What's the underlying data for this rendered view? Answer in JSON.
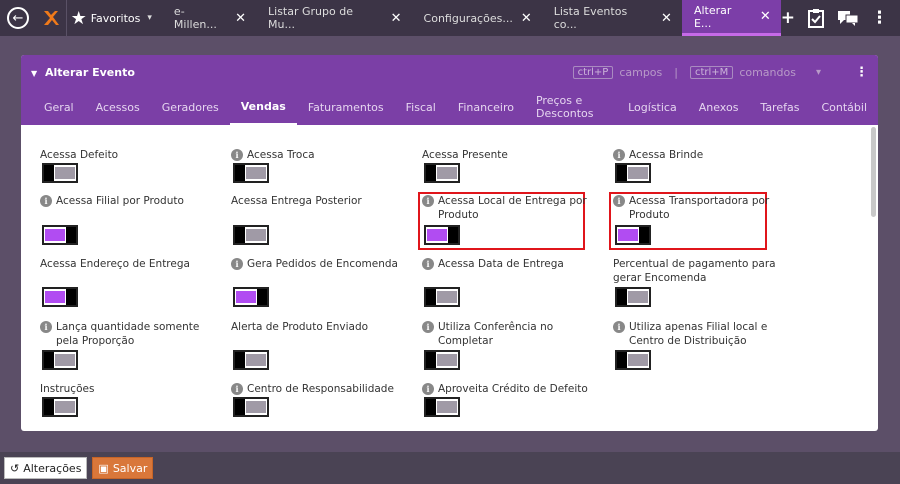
{
  "topbar": {
    "favorites_label": "Favoritos",
    "tabs": [
      {
        "label": "e-Millen..."
      },
      {
        "label": "Listar Grupo de Mu..."
      },
      {
        "label": "Configurações..."
      },
      {
        "label": "Lista Eventos co..."
      },
      {
        "label": "Alterar E..."
      }
    ],
    "close_glyph": "✕"
  },
  "panel": {
    "title": "Alterar Evento",
    "shortcut_fields_key": "ctrl+P",
    "shortcut_fields_label": "campos",
    "shortcut_commands_key": "ctrl+M",
    "shortcut_commands_label": "comandos",
    "tabs": [
      "Geral",
      "Acessos",
      "Geradores",
      "Vendas",
      "Faturamentos",
      "Fiscal",
      "Financeiro",
      "Preços e Descontos",
      "Logística",
      "Anexos",
      "Tarefas",
      "Contábil"
    ],
    "active_tab": "Vendas"
  },
  "fields": [
    {
      "label": "Acessa Defeito",
      "info": false,
      "on": false
    },
    {
      "label": "Acessa Troca",
      "info": true,
      "on": false
    },
    {
      "label": "Acessa Presente",
      "info": false,
      "on": false
    },
    {
      "label": "Acessa Brinde",
      "info": true,
      "on": false
    },
    {
      "label": "Acessa Filial por Produto",
      "info": true,
      "on": true
    },
    {
      "label": "Acessa Entrega Posterior",
      "info": false,
      "on": false
    },
    {
      "label": "Acessa Local de Entrega por Produto",
      "info": true,
      "on": true
    },
    {
      "label": "Acessa Transportadora por Produto",
      "info": true,
      "on": true
    },
    {
      "label": "Acessa Endereço de Entrega",
      "info": false,
      "on": true
    },
    {
      "label": "Gera Pedidos de Encomenda",
      "info": true,
      "on": true
    },
    {
      "label": "Acessa Data de Entrega",
      "info": true,
      "on": false
    },
    {
      "label": "Percentual de pagamento para gerar Encomenda",
      "info": false,
      "on": false
    },
    {
      "label": "Lança quantidade somente pela Proporção",
      "info": true,
      "on": false
    },
    {
      "label": "Alerta de Produto Enviado",
      "info": false,
      "on": false
    },
    {
      "label": "Utiliza Conferência no Completar",
      "info": true,
      "on": false
    },
    {
      "label": "Utiliza apenas Filial local e Centro de Distribuição",
      "info": true,
      "on": false
    },
    {
      "label": "Instruções",
      "info": false,
      "on": false
    },
    {
      "label": "Centro de Responsabilidade",
      "info": true,
      "on": false
    },
    {
      "label": "Aproveita Crédito de Defeito",
      "info": true,
      "on": false
    }
  ],
  "bottom": {
    "changes_label": "Alterações",
    "save_label": "Salvar"
  },
  "colors": {
    "accent": "#7b3fa6",
    "toggle_on": "#b14cf2",
    "highlight": "#e0151b"
  }
}
